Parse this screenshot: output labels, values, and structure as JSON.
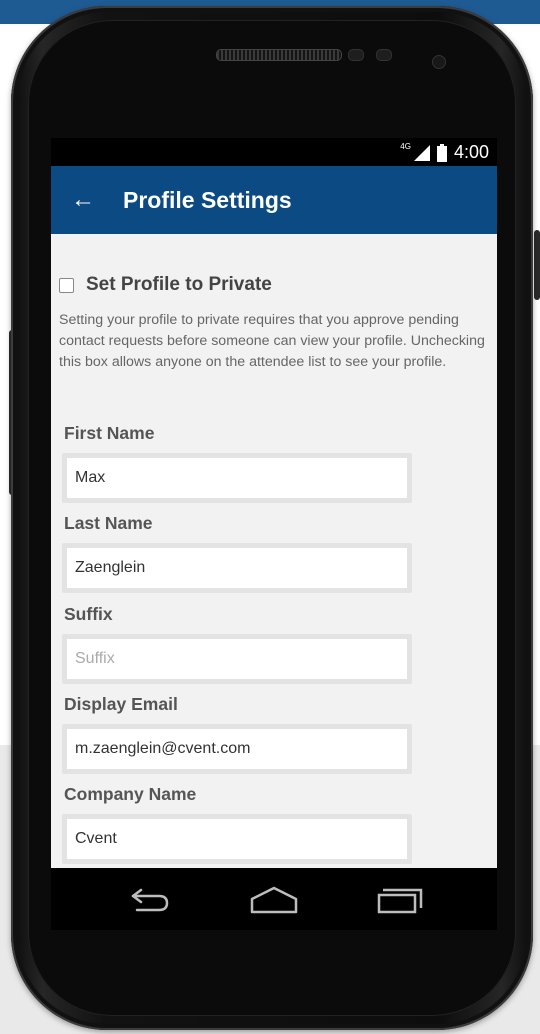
{
  "status_bar": {
    "network": "4G",
    "signal_icon": "signal-icon",
    "battery_icon": "battery-icon",
    "time": "4:00"
  },
  "app_bar": {
    "back_icon": "back-arrow-icon",
    "title": "Profile Settings",
    "color": "#0c4a83"
  },
  "privacy": {
    "checked": false,
    "label": "Set Profile to Private",
    "description": "Setting your profile to private requires that you approve pending contact requests before someone can view your profile. Unchecking this box allows anyone on the attendee list to see your profile."
  },
  "fields": [
    {
      "label": "First Name",
      "value": "Max",
      "placeholder": ""
    },
    {
      "label": "Last Name",
      "value": "Zaenglein",
      "placeholder": ""
    },
    {
      "label": "Suffix",
      "value": "",
      "placeholder": "Suffix"
    },
    {
      "label": "Display Email",
      "value": "m.zaenglein@cvent.com",
      "placeholder": ""
    },
    {
      "label": "Company Name",
      "value": "Cvent",
      "placeholder": ""
    }
  ],
  "nav_bar": {
    "back_icon": "nav-back-icon",
    "home_icon": "nav-home-icon",
    "recents_icon": "nav-recents-icon"
  },
  "accent_color": "#1f5b93"
}
